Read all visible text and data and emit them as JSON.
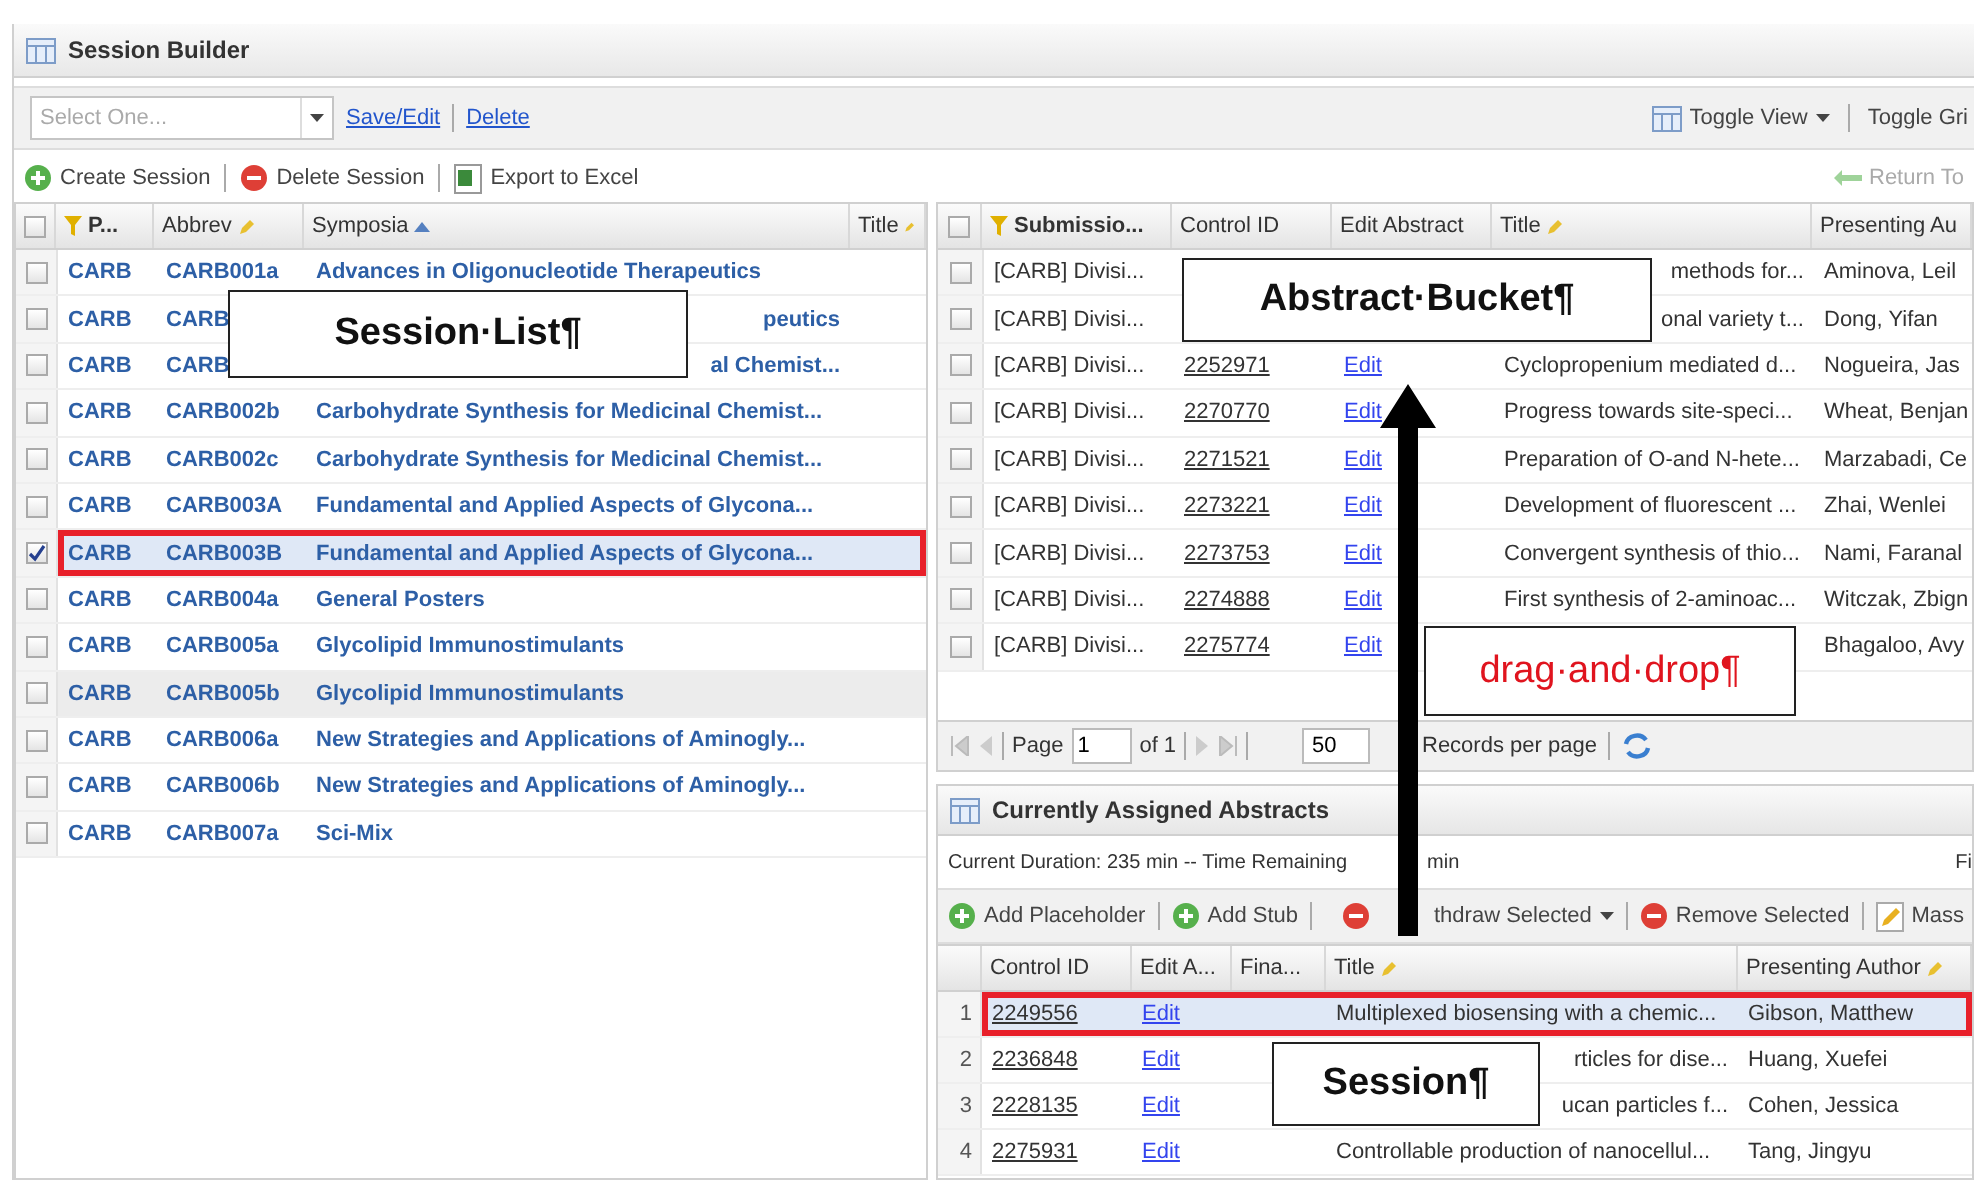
{
  "window": {
    "title": "Session Builder"
  },
  "session_select": {
    "placeholder": "Select One..."
  },
  "session_links": [
    "Save/Edit",
    "Delete"
  ],
  "view_tools": [
    {
      "label": "Toggle View",
      "kind": "menu"
    },
    {
      "label": "Toggle Gri",
      "kind": "plain"
    }
  ],
  "session_toolbar": [
    {
      "label": "Create Session",
      "kind": "add"
    },
    {
      "label": "Delete Session",
      "kind": "remove"
    },
    {
      "label": "Export to Excel",
      "kind": "excel"
    }
  ],
  "return_button": {
    "label": "Return To",
    "disabled": true
  },
  "session_list": {
    "all_checked": false,
    "columns": [
      "P...",
      "Abbrev",
      "Symposia",
      "Title"
    ],
    "rows": [
      {
        "program": "CARB",
        "abbrev": "CARB001a",
        "symposia": "Advances in Oligonucleotide Therapeutics",
        "checked": false,
        "selected": false,
        "outlined": false,
        "hovered": false
      },
      {
        "program": "CARB",
        "abbrev": "CARB",
        "symposia": "peutics",
        "checked": false,
        "selected": false,
        "outlined": false,
        "hovered": false
      },
      {
        "program": "CARB",
        "abbrev": "CARB",
        "symposia": "al Chemist...",
        "checked": false,
        "selected": false,
        "outlined": false,
        "hovered": false
      },
      {
        "program": "CARB",
        "abbrev": "CARB002b",
        "symposia": "Carbohydrate Synthesis for Medicinal Chemist...",
        "checked": false,
        "selected": false,
        "outlined": false,
        "hovered": false
      },
      {
        "program": "CARB",
        "abbrev": "CARB002c",
        "symposia": "Carbohydrate Synthesis for Medicinal Chemist...",
        "checked": false,
        "selected": false,
        "outlined": false,
        "hovered": false
      },
      {
        "program": "CARB",
        "abbrev": "CARB003A",
        "symposia": "Fundamental and Applied Aspects of Glycona...",
        "checked": false,
        "selected": false,
        "outlined": false,
        "hovered": false
      },
      {
        "program": "CARB",
        "abbrev": "CARB003B",
        "symposia": "Fundamental and Applied Aspects of Glycona...",
        "checked": true,
        "selected": true,
        "outlined": true,
        "hovered": false
      },
      {
        "program": "CARB",
        "abbrev": "CARB004a",
        "symposia": "General Posters",
        "checked": false,
        "selected": false,
        "outlined": false,
        "hovered": false
      },
      {
        "program": "CARB",
        "abbrev": "CARB005a",
        "symposia": "Glycolipid Immunostimulants",
        "checked": false,
        "selected": false,
        "outlined": false,
        "hovered": false
      },
      {
        "program": "CARB",
        "abbrev": "CARB005b",
        "symposia": "Glycolipid Immunostimulants",
        "checked": false,
        "selected": false,
        "outlined": false,
        "hovered": true
      },
      {
        "program": "CARB",
        "abbrev": "CARB006a",
        "symposia": "New Strategies and Applications of Aminogly...",
        "checked": false,
        "selected": false,
        "outlined": false,
        "hovered": false
      },
      {
        "program": "CARB",
        "abbrev": "CARB006b",
        "symposia": "New Strategies and Applications of Aminogly...",
        "checked": false,
        "selected": false,
        "outlined": false,
        "hovered": false
      },
      {
        "program": "CARB",
        "abbrev": "CARB007a",
        "symposia": "Sci-Mix",
        "checked": false,
        "selected": false,
        "outlined": false,
        "hovered": false
      }
    ]
  },
  "abstract_bucket": {
    "all_checked": false,
    "columns": [
      "Submissio...",
      "Control ID",
      "Edit Abstract",
      "Title",
      "Presenting Au"
    ],
    "rows": [
      {
        "submission": "[CARB] Divisi...",
        "title": "methods for...",
        "author": "Aminova, Leil",
        "checked": false
      },
      {
        "submission": "[CARB] Divisi...",
        "title": "onal variety t...",
        "author": "Dong, Yifan",
        "checked": false
      },
      {
        "submission": "[CARB] Divisi...",
        "control_id": "2252971",
        "edit": "Edit",
        "title": "Cyclopropenium mediated d...",
        "author": "Nogueira, Jas",
        "checked": false
      },
      {
        "submission": "[CARB] Divisi...",
        "control_id": "2270770",
        "edit": "Edit",
        "title": "Progress towards site-speci...",
        "author": "Wheat, Benjan",
        "checked": false
      },
      {
        "submission": "[CARB] Divisi...",
        "control_id": "2271521",
        "edit": "Edit",
        "title": "Preparation of O-and N-hete...",
        "author": "Marzabadi, Ce",
        "checked": false
      },
      {
        "submission": "[CARB] Divisi...",
        "control_id": "2273221",
        "edit": "Edit",
        "title": "Development of fluorescent ...",
        "author": "Zhai, Wenlei",
        "checked": false
      },
      {
        "submission": "[CARB] Divisi...",
        "control_id": "2273753",
        "edit": "Edit",
        "title": "Convergent synthesis of thio...",
        "author": "Nami, Faranal",
        "checked": false
      },
      {
        "submission": "[CARB] Divisi...",
        "control_id": "2274888",
        "edit": "Edit",
        "title": "First synthesis of 2-aminoac...",
        "author": "Witczak, Zbign",
        "checked": false
      },
      {
        "submission": "[CARB] Divisi...",
        "control_id": "2275774",
        "edit": "Edit",
        "author": "Bhagaloo, Avy",
        "checked": false
      }
    ]
  },
  "pager": {
    "page_label": "Page",
    "page": "1",
    "of": "of 1",
    "page_size": "50",
    "records_label": "Records per page"
  },
  "assigned": {
    "title": "Currently Assigned Abstracts",
    "status": [
      "Current Duration: 235 min -- Time Remaining",
      "min"
    ],
    "status_right": "Fi",
    "toolbar": [
      {
        "label": "Add Placeholder",
        "kind": "add"
      },
      {
        "label": "Add Stub",
        "kind": "add"
      },
      {
        "label": "thdraw Selected",
        "kind": "remove_menu"
      },
      {
        "label": "Remove Selected",
        "kind": "remove"
      },
      {
        "label": "Mass",
        "kind": "pencil"
      }
    ],
    "columns": [
      "Control ID",
      "Edit A...",
      "Fina...",
      "Title",
      "Presenting Author"
    ],
    "rows": [
      {
        "number": "1",
        "control_id": "2249556",
        "edit": "Edit",
        "title": "Multiplexed biosensing with a chemic...",
        "author": "Gibson, Matthew",
        "selected": true,
        "outlined": true
      },
      {
        "number": "2",
        "control_id": "2236848",
        "edit": "Edit",
        "title": "rticles for dise...",
        "author": "Huang, Xuefei",
        "selected": false,
        "outlined": false
      },
      {
        "number": "3",
        "control_id": "2228135",
        "edit": "Edit",
        "title": "ucan particles f...",
        "author": "Cohen, Jessica",
        "selected": false,
        "outlined": false
      },
      {
        "number": "4",
        "control_id": "2275931",
        "edit": "Edit",
        "title": "Controllable production of nanocellul...",
        "author": "Tang, Jingyu",
        "selected": false,
        "outlined": false
      }
    ]
  },
  "callouts": [
    {
      "text": "Session·List¶",
      "kind": "plain"
    },
    {
      "text": "Abstract·Bucket¶",
      "kind": "plain"
    },
    {
      "text": "drag·and·drop¶",
      "kind": "marked"
    },
    {
      "text": "Session¶",
      "kind": "plain"
    }
  ]
}
